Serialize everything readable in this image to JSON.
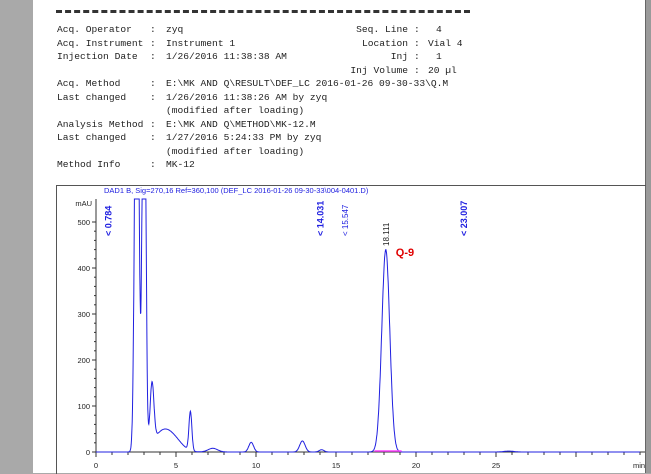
{
  "header": {
    "rows": [
      {
        "label": "Acq. Operator",
        "value": "zyq"
      },
      {
        "label": "Acq. Instrument",
        "value": "Instrument 1"
      },
      {
        "label": "Injection Date",
        "value": "1/26/2016 11:38:38 AM"
      },
      {
        "label": "",
        "value": ""
      },
      {
        "label": "Acq. Method",
        "value": "E:\\MK AND Q\\RESULT\\DEF_LC 2016-01-26 09-30-33\\Q.M"
      },
      {
        "label": "Last changed",
        "value": "1/26/2016 11:38:26 AM by zyq"
      },
      {
        "label": "",
        "value": "(modified after loading)"
      },
      {
        "label": "Analysis Method",
        "value": "E:\\MK AND Q\\METHOD\\MK-12.M"
      },
      {
        "label": "Last changed",
        "value": "1/27/2016 5:24:33 PM by zyq"
      },
      {
        "label": "",
        "value": "(modified after loading)"
      },
      {
        "label": "Method Info",
        "value": "MK-12"
      }
    ],
    "right": [
      {
        "label": "Seq. Line",
        "value": "4"
      },
      {
        "label": "Location",
        "value": "Vial 4"
      },
      {
        "label": "Inj",
        "value": "1"
      },
      {
        "label": "Inj Volume",
        "value": "20 µl"
      }
    ]
  },
  "chart_data": {
    "type": "line",
    "title": "DAD1 B, Sig=270,16 Ref=360,100 (DEF_LC 2016-01-26 09-30-33\\004-0401.D)",
    "xlabel": "min",
    "ylabel": "mAU",
    "xlim": [
      0,
      30
    ],
    "ylim": [
      -10,
      550
    ],
    "xticks": [
      0,
      5,
      10,
      15,
      20,
      25
    ],
    "yticks": [
      0,
      100,
      200,
      300,
      400,
      500
    ],
    "peaks": [
      {
        "rt": 2.55,
        "height": 1200,
        "width": 0.12
      },
      {
        "rt": 3.0,
        "height": 1200,
        "width": 0.1
      },
      {
        "rt": 3.5,
        "height": 130,
        "width": 0.12
      },
      {
        "rt": 4.2,
        "height": 45,
        "width": 0.6
      },
      {
        "rt": 5.0,
        "height": 15,
        "width": 0.5
      },
      {
        "rt": 5.9,
        "height": 85,
        "width": 0.09
      },
      {
        "rt": 7.3,
        "height": 8,
        "width": 0.3
      },
      {
        "rt": 9.7,
        "height": 21,
        "width": 0.15
      },
      {
        "rt": 12.9,
        "height": 24,
        "width": 0.17
      },
      {
        "rt": 14.1,
        "height": 5,
        "width": 0.15
      },
      {
        "rt": 18.111,
        "height": 440,
        "width": 0.25
      },
      {
        "rt": 25.8,
        "height": 2,
        "width": 0.3
      }
    ],
    "annotations": [
      {
        "rt": 0.784,
        "text": "< 0.784",
        "bold": true
      },
      {
        "rt": 14.031,
        "text": "< 14.031",
        "bold": true
      },
      {
        "rt": 15.547,
        "text": "< 15.547",
        "bold": false
      },
      {
        "rt": 18.111,
        "text": "18.111",
        "bold": false
      },
      {
        "rt": 23.007,
        "text": "< 23.007",
        "bold": true
      }
    ],
    "peak_label": {
      "rt": 18.111,
      "text": "Q-9"
    },
    "colors": {
      "trace": "#2020e0",
      "label": "#2020e0",
      "peak_label": "#e00000",
      "baseline": "#ff40ff"
    }
  }
}
